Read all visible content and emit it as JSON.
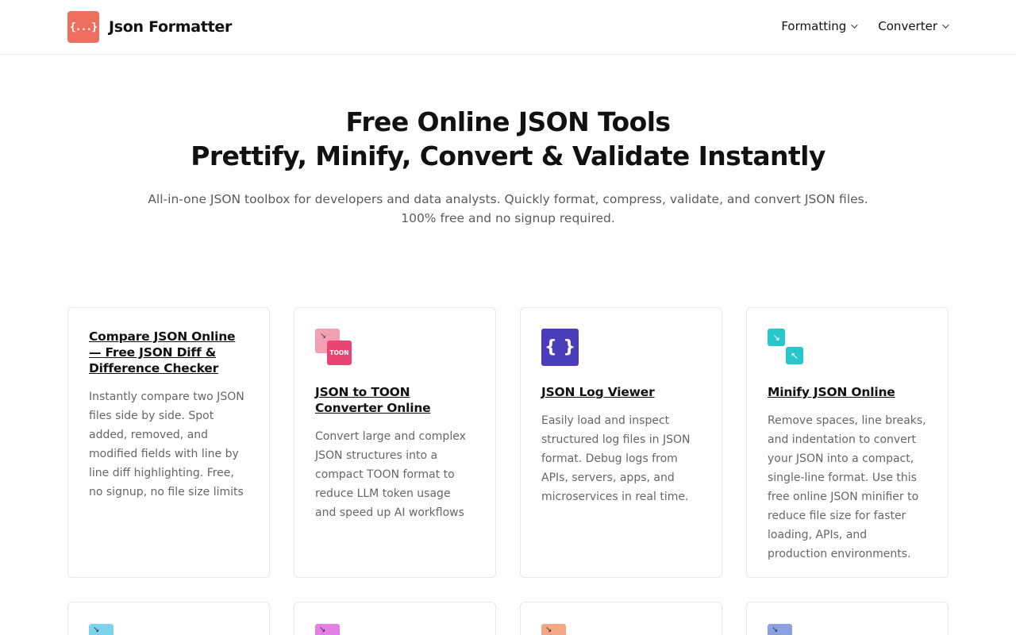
{
  "header": {
    "logo_text": "{...}",
    "brand_name": "Json Formatter",
    "nav": [
      {
        "label": "Formatting"
      },
      {
        "label": "Converter"
      }
    ]
  },
  "hero": {
    "title_line1": "Free Online JSON Tools",
    "title_line2": "Prettify, Minify, Convert & Validate Instantly",
    "subtitle_line1": "All-in-one JSON toolbox for developers and data analysts. Quickly format, compress, validate, and convert JSON files.",
    "subtitle_line2": "100% free and no signup required."
  },
  "cards": [
    {
      "title": "Compare JSON Online — Free JSON Diff & Difference Checker",
      "description": "Instantly compare two JSON files side by side. Spot added, removed, and modified fields with line by line diff highlighting. Free, no signup, no file size limits",
      "icon": "none"
    },
    {
      "title": "JSON to TOON Converter Online",
      "description": "Convert large and complex JSON structures into a compact TOON format to reduce LLM token usage and speed up AI workflows",
      "icon": "toon-convert-icon",
      "icon_label": "TOON",
      "icon_colors": [
        "#f3a0b4",
        "#e94473"
      ]
    },
    {
      "title": "JSON Log Viewer",
      "description": "Easily load and inspect structured log files in JSON format. Debug logs from APIs, servers, apps, and microservices in real time.",
      "icon": "braces-icon",
      "icon_label": "{ }",
      "icon_colors": [
        "#4b3dba"
      ]
    },
    {
      "title": "Minify JSON Online",
      "description": "Remove spaces, line breaks, and indentation to convert your JSON into a compact, single-line format. Use this free online JSON minifier to reduce file size for faster loading, APIs, and production environments.",
      "icon": "minify-arrows-icon",
      "icon_colors": [
        "#27c7cd"
      ]
    }
  ],
  "second_row_icons": [
    {
      "icon": "arrow-icon",
      "color": "#7dd3ec"
    },
    {
      "icon": "arrow-icon",
      "color": "#e47fe6"
    },
    {
      "icon": "arrow-icon",
      "color": "#f2a884"
    },
    {
      "icon": "arrow-icon",
      "color": "#8aa3e0"
    }
  ],
  "colors": {
    "logo": "#ee6f60",
    "border": "#e5e7eb",
    "muted_text": "#666666"
  }
}
